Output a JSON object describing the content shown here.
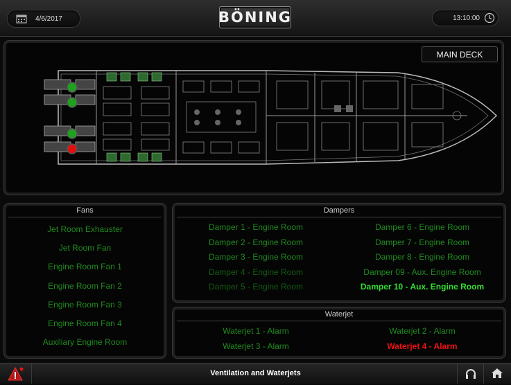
{
  "header": {
    "date": "4/6/2017",
    "logo": "BÖNING",
    "time": "13:10:00"
  },
  "deck": {
    "view_button": "MAIN DECK",
    "indicators": [
      {
        "color": "#1fa01f"
      },
      {
        "color": "#1fa01f"
      },
      {
        "color": "#1fa01f"
      },
      {
        "color": "#e01010"
      }
    ]
  },
  "fans": {
    "title": "Fans",
    "items": [
      "Jet Room Exhauster",
      "Jet Room Fan",
      "Engine Room Fan 1",
      "Engine Room Fan 2",
      "Engine Room Fan 3",
      "Engine Room Fan 4",
      "Auxiliary Engine Room"
    ]
  },
  "dampers": {
    "title": "Dampers",
    "items": [
      "Damper 1 - Engine Room",
      "Damper 6 - Engine Room",
      "Damper 2 - Engine Room",
      "Damper 7 - Engine Room",
      "Damper 3 - Engine Room",
      "Damper 8 - Engine Room",
      "Damper 4 - Engine Room",
      "Damper 09 - Aux. Engine Room",
      "Damper 5 - Engine Room",
      "Damper 10 - Aux. Engine Room"
    ]
  },
  "waterjet": {
    "title": "Waterjet",
    "items": [
      "Waterjet 1 - Alarm",
      "Waterjet 2 - Alarm",
      "Waterjet 3 - Alarm",
      "Waterjet 4 - Alarm"
    ]
  },
  "footer": {
    "title": "Ventilation and Waterjets"
  },
  "colors": {
    "ok": "#1f8a1f",
    "active": "#33dd33",
    "alarm": "#ee1111"
  }
}
